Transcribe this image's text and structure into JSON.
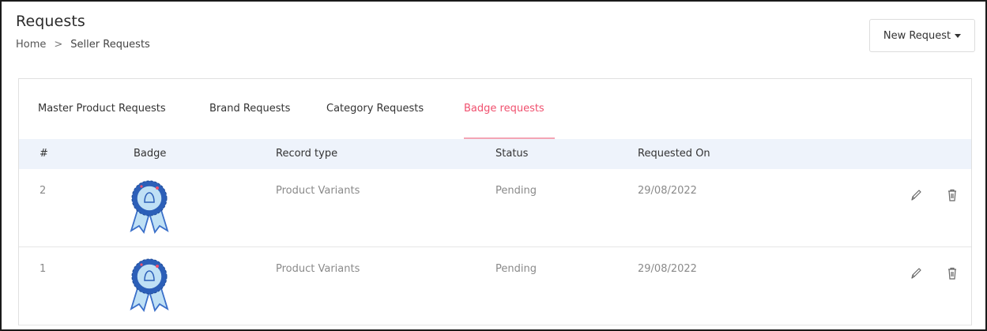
{
  "header": {
    "title": "Requests",
    "breadcrumb": {
      "home": "Home",
      "separator": ">",
      "current": "Seller Requests"
    },
    "new_request_label": "New Request"
  },
  "tabs": [
    {
      "label": "Master Product Requests",
      "active": false
    },
    {
      "label": "Brand Requests",
      "active": false
    },
    {
      "label": "Category Requests",
      "active": false
    },
    {
      "label": "Badge requests",
      "active": true
    }
  ],
  "table": {
    "columns": [
      "#",
      "Badge",
      "Record type",
      "Status",
      "Requested On"
    ],
    "rows": [
      {
        "id": "2",
        "badge_icon": "award-ribbon-icon",
        "record_type": "Product Variants",
        "status": "Pending",
        "requested_on": "29/08/2022"
      },
      {
        "id": "1",
        "badge_icon": "award-ribbon-icon",
        "record_type": "Product Variants",
        "status": "Pending",
        "requested_on": "29/08/2022"
      }
    ]
  },
  "colors": {
    "accent": "#f0506e",
    "table_header_bg": "#eef3fb",
    "badge_blue": "#3a6fc9",
    "badge_light": "#bfe0f5"
  },
  "icons": {
    "edit": "pencil-icon",
    "delete": "trash-icon",
    "dropdown": "caret-down-icon"
  }
}
